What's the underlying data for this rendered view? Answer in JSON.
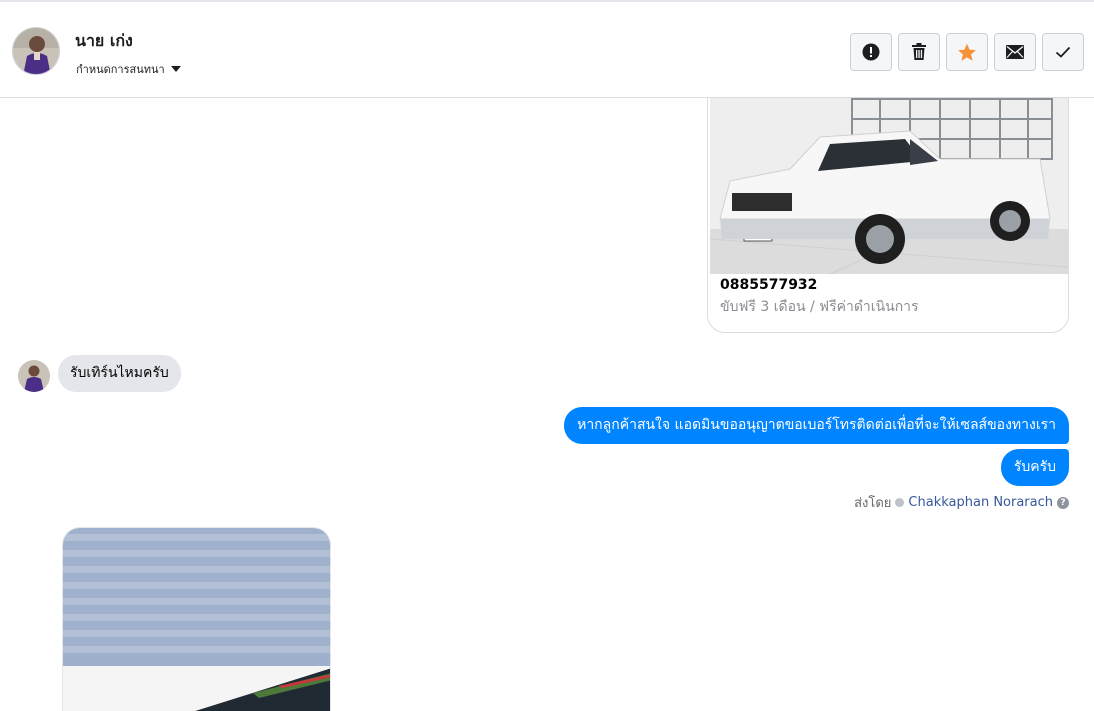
{
  "header": {
    "contact_name": "นาย เก่ง",
    "conversation_status": "กำหนดการสนทนา",
    "actions": [
      {
        "name": "spam",
        "icon": "exclamation-circle-icon"
      },
      {
        "name": "delete",
        "icon": "trash-icon"
      },
      {
        "name": "star",
        "icon": "star-icon"
      },
      {
        "name": "mark-unread",
        "icon": "envelope-icon"
      },
      {
        "name": "done",
        "icon": "check-icon"
      }
    ]
  },
  "messages": {
    "card": {
      "title": "0885577932",
      "subtitle": "ขับฟรี 3 เดือน / ฟรีค่าดำเนินการ",
      "image_icon": "pickup-truck-photo"
    },
    "incoming_text": "รับเทิร์นไหมครับ",
    "outgoing": [
      "หากลูกค้าสนใจ แอดมินขออนุญาตขอเบอร์โทรติดต่อเพื่อที่จะให้เซลส์ของทางเรา",
      "รับครับ"
    ],
    "sent_by": {
      "label": "ส่งโดย",
      "agent": "Chakkaphan Norarach",
      "help_glyph": "?"
    }
  },
  "colors": {
    "accent": "#0084ff",
    "star": "#f7923b",
    "incoming_bubble": "#e4e6eb"
  }
}
